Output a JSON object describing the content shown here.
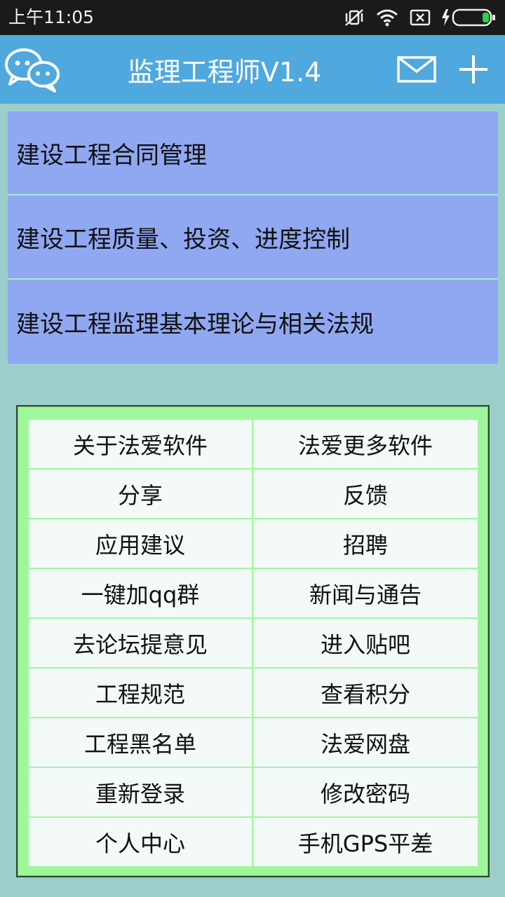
{
  "status_bar": {
    "time": "上午11:05",
    "icons": [
      "vibrate-off-icon",
      "wifi-icon",
      "sim-off-icon",
      "battery-charging-icon"
    ]
  },
  "app_bar": {
    "title": "监理工程师V1.4",
    "icons": [
      "chat-logo-icon",
      "mail-icon",
      "plus-icon"
    ]
  },
  "menu": {
    "items": [
      {
        "label": "建设工程合同管理"
      },
      {
        "label": "建设工程质量、投资、进度控制"
      },
      {
        "label": "建设工程监理基本理论与相关法规"
      }
    ]
  },
  "grid": {
    "rows": [
      {
        "left": "关于法爱软件",
        "right": "法爱更多软件"
      },
      {
        "left": "分享",
        "right": "反馈"
      },
      {
        "left": "应用建议",
        "right": "招聘"
      },
      {
        "left": "一键加qq群",
        "right": "新闻与通告"
      },
      {
        "left": "去论坛提意见",
        "right": "进入贴吧"
      },
      {
        "left": "工程规范",
        "right": "查看积分"
      },
      {
        "left": "工程黑名单",
        "right": "法爱网盘"
      },
      {
        "left": "重新登录",
        "right": "修改密码"
      },
      {
        "left": "个人中心",
        "right": "手机GPS平差"
      }
    ]
  },
  "colors": {
    "app_bar": "#4fa8de",
    "menu_item": "#90a8f2",
    "panel_border": "#9ff79c",
    "background": "#9ccfcb"
  }
}
